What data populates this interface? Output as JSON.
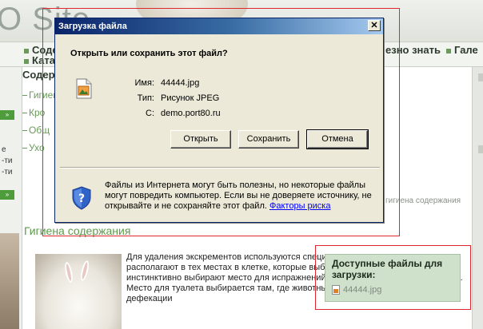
{
  "background": {
    "logo_text": "O Site",
    "nav": [
      "Соде",
      "Ката",
      "езно знать",
      "Гале"
    ],
    "left_menu_title": "Содер",
    "left_links": [
      "Гигиен",
      "Кро",
      "Общ",
      "Ухо"
    ],
    "left_fragments": [
      "е",
      "-ти",
      "-ти"
    ],
    "breadcrumb": "гигиена содержания",
    "section_title": "Гигиена содержания",
    "article_text": "Для удаления экскрементов используются специальные емкости, которые располагают в тех местах в клетке, которые выберут сами кролики. Кролики инстинктивно выбирают место для испражнений, а не оставляют их по всей норе. Место для туалета выбирается там, где животные чаще всего осуществляют акт дефекации",
    "files_box": {
      "title": "Доступные файлы для загрузки:",
      "file": "44444.jpg"
    }
  },
  "dialog": {
    "title": "Загрузка файла",
    "close_glyph": "✕",
    "question": "Открыть или сохранить этот файл?",
    "labels": {
      "name": "Имя:",
      "type": "Тип:",
      "from": "С:"
    },
    "values": {
      "name": "44444.jpg",
      "type": "Рисунок JPEG",
      "from": "demo.port80.ru"
    },
    "buttons": {
      "open": "Открыть",
      "save": "Сохранить",
      "cancel": "Отмена"
    },
    "warning": "Файлы из Интернета могут быть полезны, но некоторые файлы могут повредить компьютер. Если вы не доверяете источнику, не открывайте и не сохраняйте этот файл.",
    "warning_link": "Факторы риска"
  },
  "colors": {
    "titlebar": "#0a246a",
    "dialog_bg": "#ece9d8",
    "annotation": "#e0262e",
    "site_green": "#5c9a49"
  }
}
